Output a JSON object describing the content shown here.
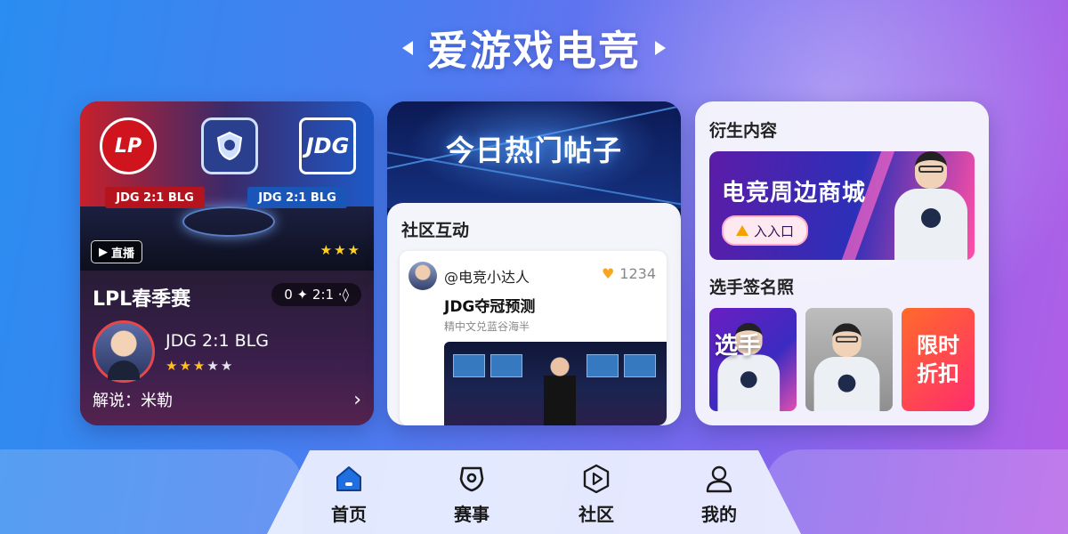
{
  "header": {
    "title": "爱游戏电竞"
  },
  "live_card": {
    "badge": "直播",
    "desk_left": "JDG 2:1 BLG",
    "desk_right": "JDG 2:1 BLG",
    "logo_left": "LP",
    "logo_right": "JDG",
    "league": "LPL春季赛",
    "score": "0 ✦ 2:1 ·◊",
    "match": "JDG 2:1 BLG",
    "host": "解说：米勒",
    "rating_of_5": 3
  },
  "hot_card": {
    "title": "今日热门帖子",
    "section": "社区互动",
    "post": {
      "user": "@电竞小达人",
      "likes": "1234",
      "title": "JDG夺冠预测",
      "subtitle": "精中文兑蓝谷海半"
    }
  },
  "derive_card": {
    "section": "衍生内容",
    "shop_title": "电竞周边商城",
    "shop_button": "入入口",
    "sign_section": "选手签名照",
    "photo_overlay": "选手",
    "discount_line1": "限时",
    "discount_line2": "折扣"
  },
  "nav": {
    "home": "首页",
    "match": "赛事",
    "community": "社区",
    "me": "我的"
  },
  "colors": {
    "accent_blue": "#1f6fe0",
    "gold": "#ffbf1f",
    "live_red": "#d0141e"
  }
}
